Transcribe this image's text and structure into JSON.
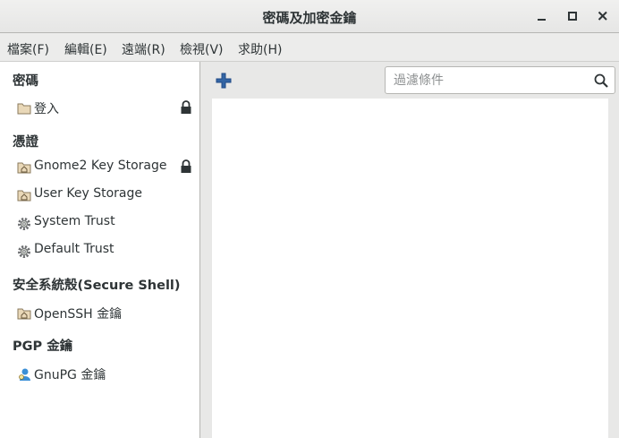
{
  "window": {
    "title": "密碼及加密金鑰",
    "minimize_label": "▁",
    "maximize_label": "□",
    "close_label": "✕"
  },
  "menubar": {
    "items": [
      {
        "label": "檔案(F)"
      },
      {
        "label": "編輯(E)"
      },
      {
        "label": "遠端(R)"
      },
      {
        "label": "檢視(V)"
      },
      {
        "label": "求助(H)"
      }
    ]
  },
  "sidebar": {
    "sections": [
      {
        "heading": "密碼",
        "items": [
          {
            "label": "登入",
            "icon": "folder-icon",
            "locked": true
          }
        ]
      },
      {
        "heading": "憑證",
        "items": [
          {
            "label": "Gnome2 Key Storage",
            "icon": "home-folder-icon",
            "locked": true
          },
          {
            "label": "User Key Storage",
            "icon": "home-folder-icon",
            "locked": false
          },
          {
            "label": "System Trust",
            "icon": "gear-icon",
            "locked": false
          },
          {
            "label": "Default Trust",
            "icon": "gear-icon",
            "locked": false
          }
        ]
      },
      {
        "heading": "安全系統殼(Secure Shell)",
        "items": [
          {
            "label": "OpenSSH 金鑰",
            "icon": "home-folder-icon",
            "locked": false
          }
        ]
      },
      {
        "heading": "PGP 金鑰",
        "items": [
          {
            "label": "GnuPG 金鑰",
            "icon": "person-key-icon",
            "locked": false
          }
        ]
      }
    ]
  },
  "toolbar": {
    "add_icon": "plus-icon",
    "search_placeholder": "過濾條件",
    "search_value": ""
  },
  "colors": {
    "accent_blue": "#3465a4",
    "sidebar_bg": "#ffffff",
    "window_bg": "#e8e8e7"
  }
}
